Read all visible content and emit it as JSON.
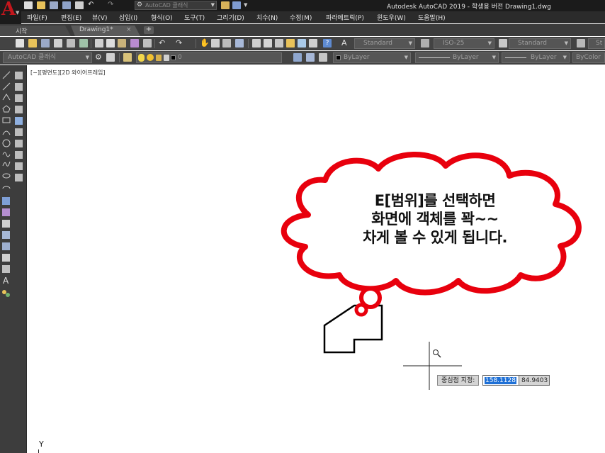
{
  "titlebar": {
    "title": "Autodesk AutoCAD 2019 - 학생용 버전    Drawing1.dwg",
    "workspace_combo": "AutoCAD 클래식"
  },
  "menu": {
    "items": [
      "파일(F)",
      "편집(E)",
      "뷰(V)",
      "삽입(I)",
      "형식(O)",
      "도구(T)",
      "그리기(D)",
      "치수(N)",
      "수정(M)",
      "파라메트릭(P)",
      "윈도우(W)",
      "도움말(H)"
    ]
  },
  "tabs": {
    "start": "시작",
    "drawing": "Drawing1*",
    "close": "×",
    "add": "+"
  },
  "toolbar1": {
    "text_style": "Standard",
    "dim_style": "ISO-25",
    "table_style": "Standard",
    "mleader_style": "St"
  },
  "toolbar2": {
    "workspace": "AutoCAD 클래식",
    "layer": "0",
    "color": "ByLayer",
    "linetype": "ByLayer",
    "lineweight": "ByLayer",
    "plotstyle": "ByColor"
  },
  "canvas": {
    "viewport_label": "[−][평면도][2D 와이어프레임]",
    "ucs_y": "Y"
  },
  "annotation": {
    "line1": "E[범위]를 선택하면",
    "line2": "화면에 객체를 꽉~~",
    "line3": "차게 볼 수 있게 됩니다."
  },
  "dynamic_input": {
    "prompt": "중심점 지정:",
    "x_value": "158.1128",
    "y_value": "84.9403"
  },
  "colors": {
    "cloud_outline": "#e8000d",
    "titlebar_bg": "#1b1b1b",
    "toolbar_bg": "#434343",
    "highlight": "#1e70d6"
  }
}
